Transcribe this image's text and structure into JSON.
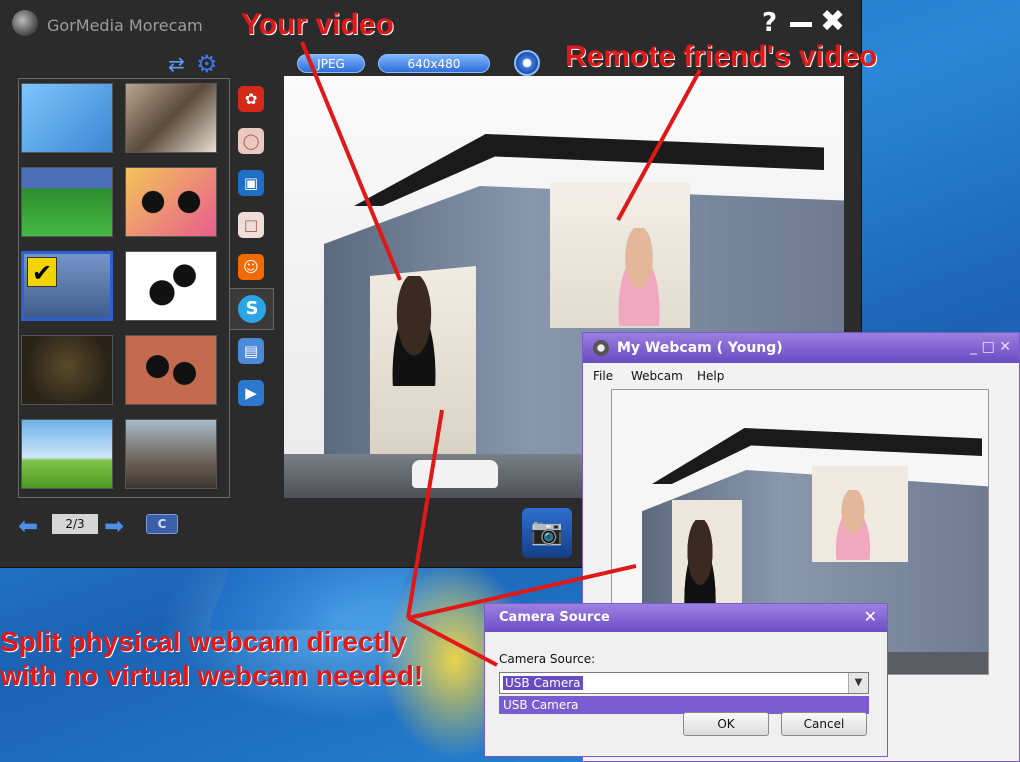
{
  "app": {
    "title": "GorMedia Morecam",
    "help_label": "?",
    "close_label": "✖",
    "format_label": "JPEG",
    "resolution_label": "640x480",
    "page_indicator": "2/3",
    "clear_label": "C",
    "icons": [
      "webcam-logo-icon",
      "sync-icon",
      "gear-icon",
      "settings-icon",
      "camera-icon",
      "prev-arrow-icon",
      "next-arrow-icon",
      "checkmark-icon",
      "skype-icon"
    ]
  },
  "annotations": {
    "your_video": "Your video",
    "remote_video": "Remote friend's video",
    "split_line1": "Split physical webcam directly",
    "split_line2": "with no virtual webcam needed!"
  },
  "webcam_window": {
    "title": "My Webcam (      Young)",
    "controls": "_ □ ✕",
    "menu": [
      "File",
      "Webcam",
      "Help"
    ]
  },
  "camera_dialog": {
    "title": "Camera Source",
    "label": "Camera Source:",
    "selected": "USB Camera",
    "options": [
      "USB Camera"
    ],
    "ok_label": "OK",
    "cancel_label": "Cancel"
  },
  "colors": {
    "annotation": "#e01818",
    "app_bg": "#2b2b2b",
    "accent": "#2d5fd4",
    "dialog_title": "#6c4ec4"
  }
}
